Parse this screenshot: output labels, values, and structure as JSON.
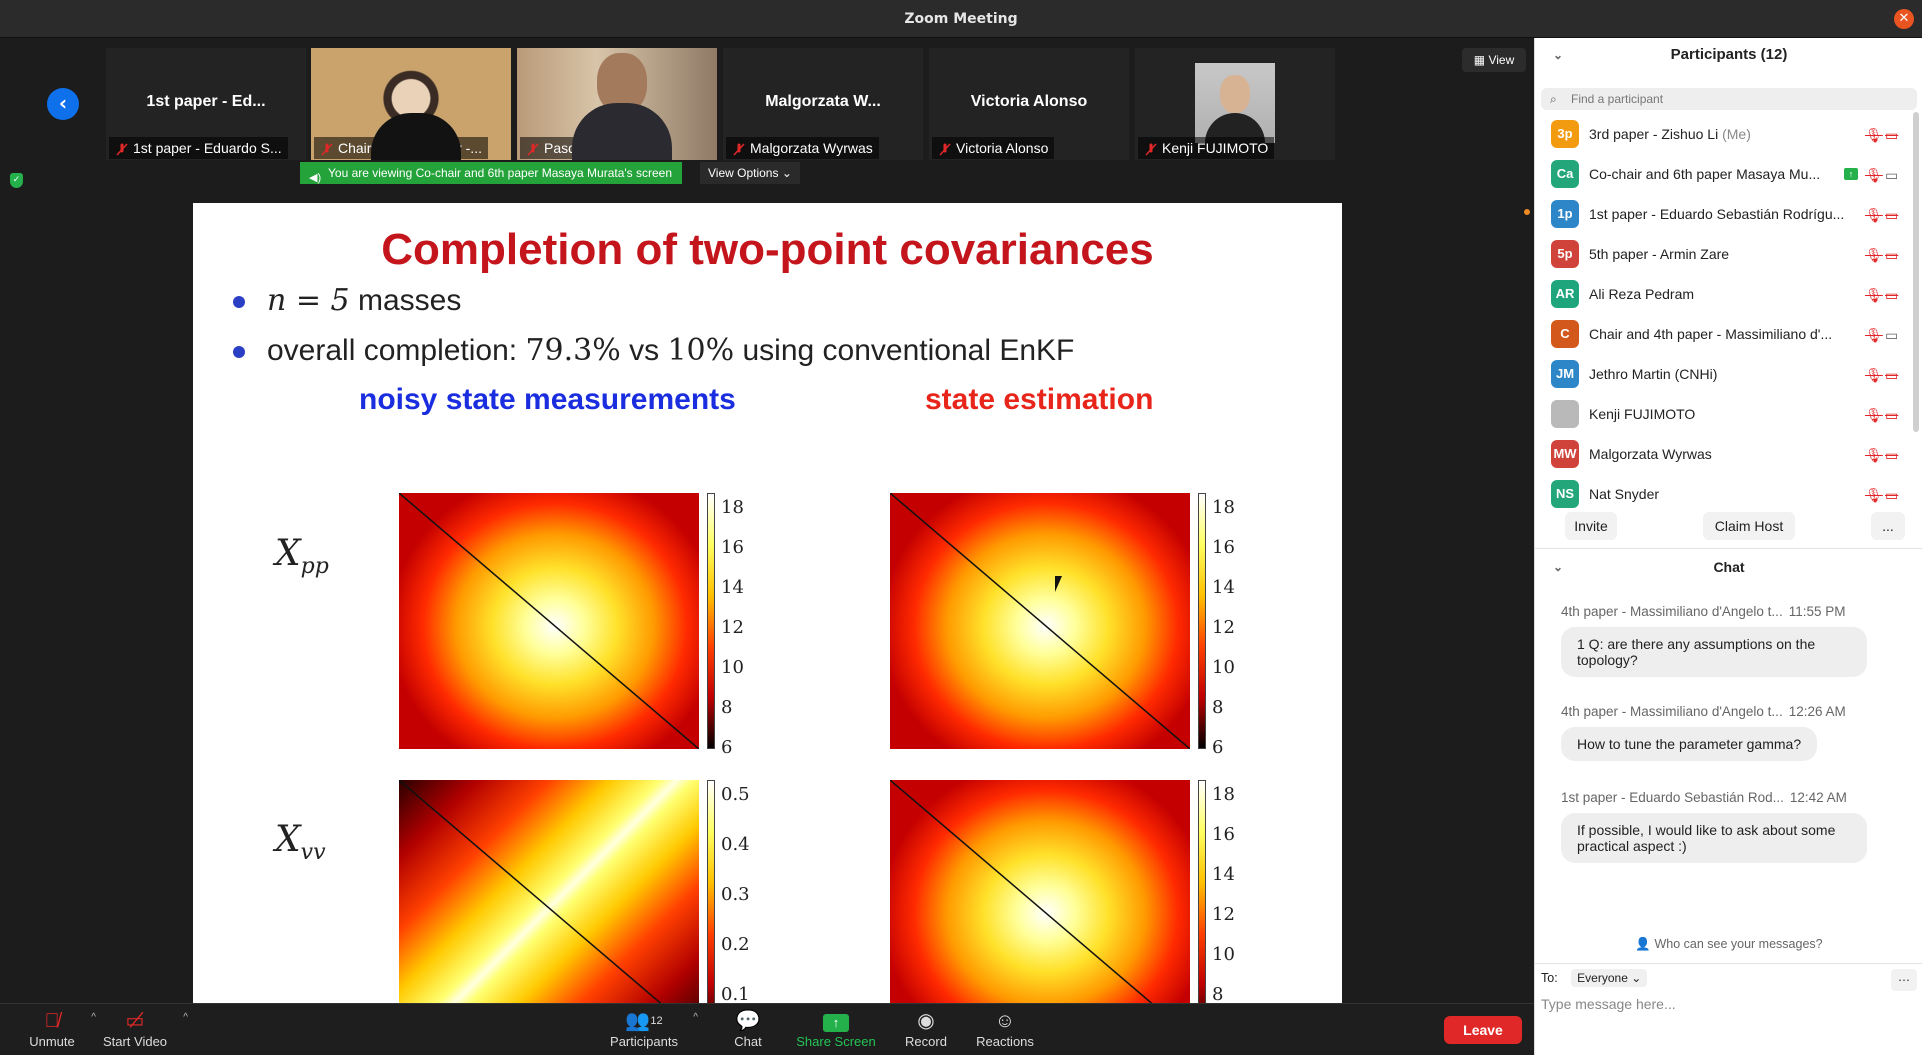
{
  "window": {
    "title": "Zoom Meeting"
  },
  "gallery": {
    "tiles": [
      {
        "big": "1st paper - Ed...",
        "label": "1st paper - Eduardo S...",
        "video": false
      },
      {
        "big": "",
        "label": "Chair  and 4th paper -...",
        "video": true
      },
      {
        "big": "",
        "label": "Pasquale Palumbo",
        "video": true
      },
      {
        "big": "Malgorzata W...",
        "label": "Malgorzata Wyrwas",
        "video": false
      },
      {
        "big": "Victoria Alonso",
        "label": "Victoria Alonso",
        "video": false
      },
      {
        "big": "",
        "label": "Kenji FUJIMOTO",
        "video": false
      }
    ],
    "banner": "You are viewing Co-chair and 6th paper Masaya Murata's screen",
    "view_options": "View Options",
    "view_button": "View"
  },
  "slide": {
    "title": "Completion of two-point covariances",
    "bullet1_math": "n = 5",
    "bullet1_text": "masses",
    "bullet2_prefix": "overall completion: ",
    "bullet2_a": "79.3%",
    "bullet2_mid": " vs ",
    "bullet2_b": "10%",
    "bullet2_suffix": " using conventional EnKF",
    "col_left": "noisy state measurements",
    "col_right": "state estimation",
    "row1_label": "X",
    "row1_sub": "pp",
    "row2_label": "X",
    "row2_sub": "vv",
    "colors": {
      "title": "#c4151c",
      "col_left": "#1a2ee0",
      "col_right": "#e8251a",
      "bullet": "#2a3fc4"
    },
    "colorbars": {
      "a": [
        "18",
        "16",
        "14",
        "12",
        "10",
        "8",
        "6"
      ],
      "b": [
        "18",
        "16",
        "14",
        "12",
        "10",
        "8",
        "6"
      ],
      "c": [
        "0.5",
        "0.4",
        "0.3",
        "0.2",
        "0.1"
      ],
      "d": [
        "18",
        "16",
        "14",
        "12",
        "10",
        "8"
      ]
    }
  },
  "toolbar": {
    "unmute": "Unmute",
    "start_video": "Start Video",
    "participants": "Participants",
    "participants_count": "12",
    "chat": "Chat",
    "share_screen": "Share Screen",
    "record": "Record",
    "reactions": "Reactions",
    "leave": "Leave"
  },
  "participants_panel": {
    "title": "Participants (12)",
    "search_placeholder": "Find a participant",
    "items": [
      {
        "initials": "3p",
        "name": "3rd paper - Zishuo Li",
        "suffix": "(Me)",
        "color": "#f29b11"
      },
      {
        "initials": "Ca",
        "name": "Co-chair and 6th paper Masaya Mu...",
        "suffix": "",
        "color": "#22a67a"
      },
      {
        "initials": "1p",
        "name": "1st paper - Eduardo Sebastián Rodrígu...",
        "suffix": "",
        "color": "#2d86c7"
      },
      {
        "initials": "5p",
        "name": "5th paper - Armin Zare",
        "suffix": "",
        "color": "#d0433a"
      },
      {
        "initials": "AR",
        "name": "Ali Reza Pedram",
        "suffix": "",
        "color": "#1fa57c"
      },
      {
        "initials": "C",
        "name": "Chair  and 4th paper - Massimiliano d'...",
        "suffix": "",
        "color": "#d2581c"
      },
      {
        "initials": "JM",
        "name": "Jethro Martin (CNHi)",
        "suffix": "",
        "color": "#2d86c7"
      },
      {
        "initials": "",
        "name": "Kenji FUJIMOTO",
        "suffix": "",
        "color": "#b9b9b9"
      },
      {
        "initials": "MW",
        "name": "Malgorzata Wyrwas",
        "suffix": "",
        "color": "#d0433a"
      },
      {
        "initials": "NS",
        "name": "Nat Snyder",
        "suffix": "",
        "color": "#22a67a"
      }
    ],
    "invite": "Invite",
    "claim_host": "Claim Host",
    "more": "..."
  },
  "chat_panel": {
    "title": "Chat",
    "messages": [
      {
        "from": "4th paper - Massimiliano d'Angelo t...",
        "time": "11:55 PM",
        "text": "1 Q: are there any assumptions on the topology?"
      },
      {
        "from": "4th paper - Massimiliano d'Angelo t...",
        "time": "12:26 AM",
        "text": "How to tune the parameter gamma?"
      },
      {
        "from": "1st paper - Eduardo Sebastián Rod...",
        "time": "12:42 AM",
        "text": "If possible, I would like to ask about some practical aspect :)"
      }
    ],
    "who_can_see": "Who can see your messages?",
    "to_label": "To:",
    "to_value": "Everyone",
    "input_placeholder": "Type message here..."
  }
}
